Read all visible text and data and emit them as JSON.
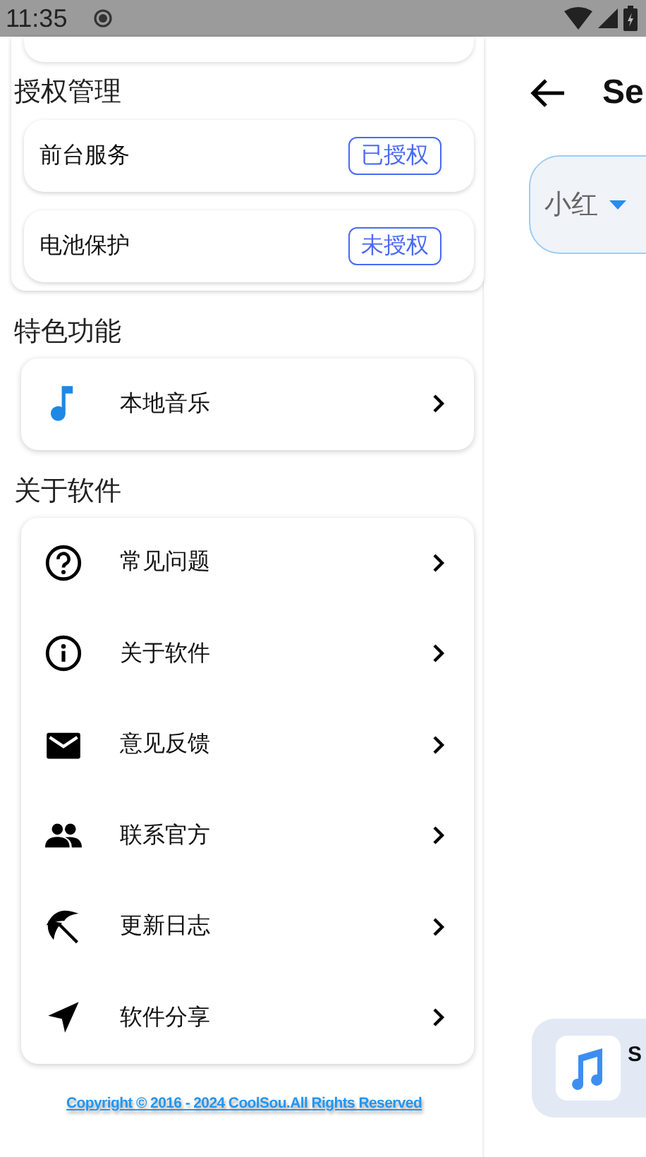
{
  "status_bar": {
    "time": "11:35"
  },
  "settings": {
    "sections": [
      {
        "title": "授权管理",
        "kind": "permissions",
        "items": [
          {
            "label": "前台服务",
            "badge": "已授权"
          },
          {
            "label": "电池保护",
            "badge": "未授权"
          }
        ]
      },
      {
        "title": "特色功能",
        "kind": "links",
        "items": [
          {
            "label": "本地音乐"
          }
        ]
      },
      {
        "title": "关于软件",
        "kind": "links",
        "items": [
          {
            "label": "常见问题"
          },
          {
            "label": "关于软件"
          },
          {
            "label": "意见反馈"
          },
          {
            "label": "联系官方"
          },
          {
            "label": "更新日志"
          },
          {
            "label": "软件分享"
          }
        ]
      }
    ],
    "copyright": "Copyright © 2016 - 2024 CoolSou.All Rights Reserved"
  },
  "side_page": {
    "title": "Se",
    "dropdown": {
      "value": "小红"
    },
    "player": {
      "title": "S"
    }
  }
}
